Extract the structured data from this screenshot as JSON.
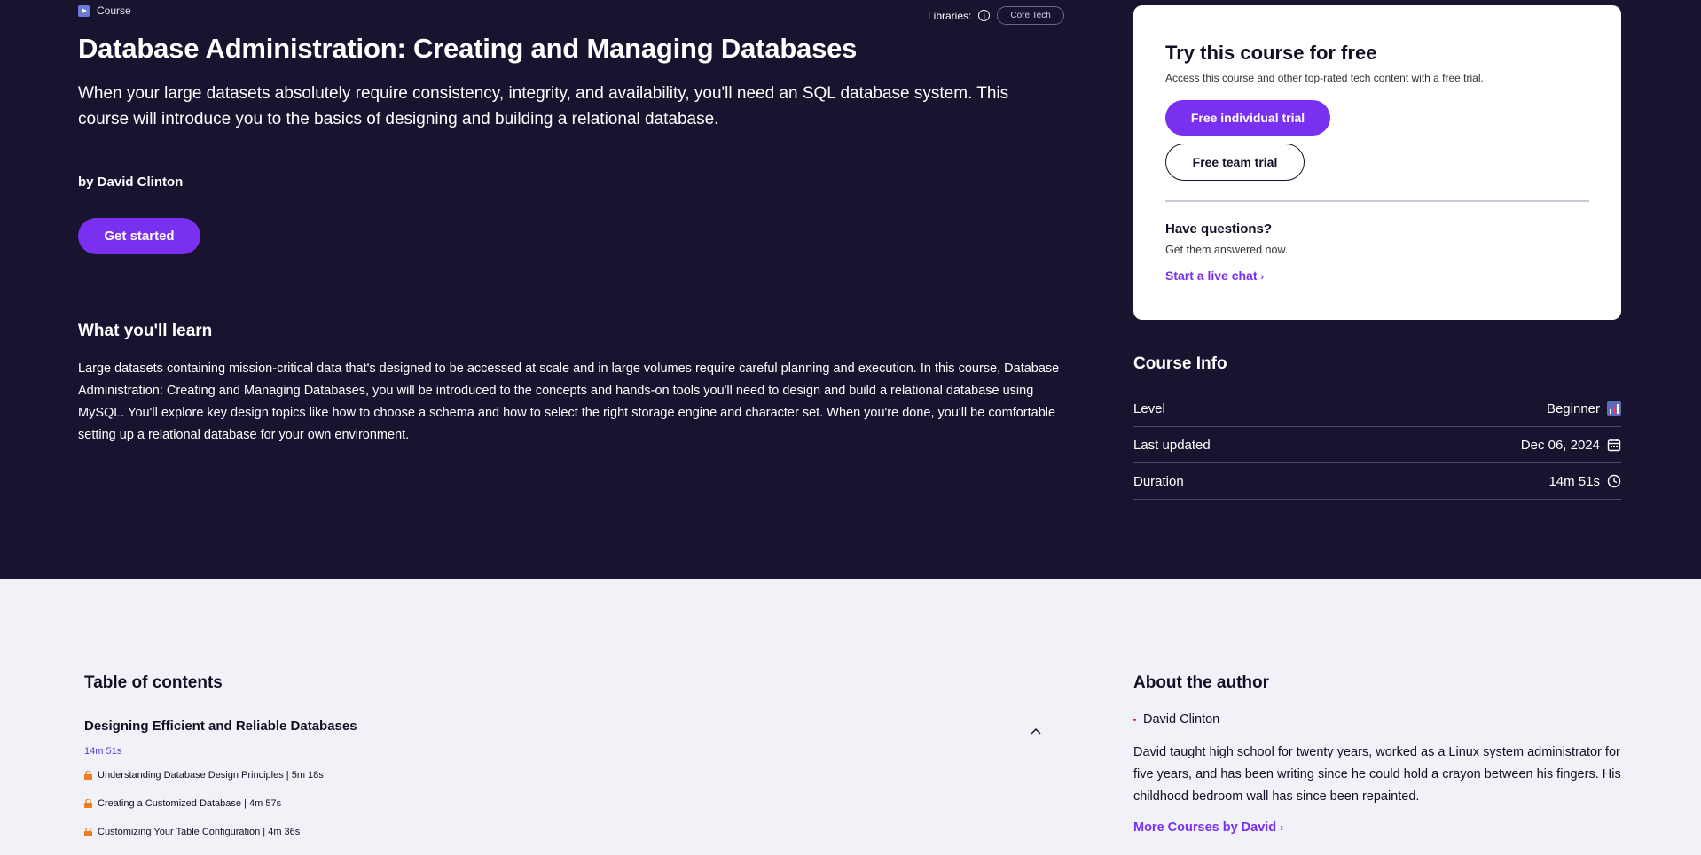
{
  "breadcrumb": {
    "label": "Course"
  },
  "libraries": {
    "label": "Libraries:",
    "chip": "Core Tech"
  },
  "course": {
    "title": "Database Administration: Creating and Managing Databases",
    "subtitle": "When your large datasets absolutely require consistency, integrity, and availability, you'll need an SQL database system. This course will introduce you to the basics of designing and building a relational database.",
    "author": "by David Clinton",
    "cta": "Get started"
  },
  "learn": {
    "heading": "What you'll learn",
    "body": "Large datasets containing mission-critical data that's designed to be accessed at scale and in large volumes require careful planning and execution. In this course, Database Administration: Creating and Managing Databases, you will be introduced to the concepts and hands-on tools you'll need to design and build a relational database using MySQL. You'll explore key design topics like how to choose a schema and how to select the right storage engine and character set. When you're done, you'll be comfortable setting up a relational database for your own environment."
  },
  "trial_card": {
    "heading": "Try this course for free",
    "sub": "Access this course and other top-rated tech content with a free trial.",
    "individual": "Free individual trial",
    "team": "Free team trial",
    "questions": "Have questions?",
    "answered": "Get them answered now.",
    "chat": "Start a live chat"
  },
  "course_info": {
    "heading": "Course Info",
    "rows": [
      {
        "label": "Level",
        "value": "Beginner",
        "icon": "bar-chart-icon"
      },
      {
        "label": "Last updated",
        "value": "Dec 06, 2024",
        "icon": "calendar-icon"
      },
      {
        "label": "Duration",
        "value": "14m 51s",
        "icon": "clock-icon"
      }
    ]
  },
  "toc": {
    "heading": "Table of contents",
    "module": {
      "title": "Designing Efficient and Reliable Databases",
      "duration": "14m 51s"
    },
    "lessons": [
      "Understanding Database Design Principles | 5m 18s",
      "Creating a Customized Database | 4m 57s",
      "Customizing Your Table Configuration | 4m 36s"
    ]
  },
  "about": {
    "heading": "About the author",
    "name": "David Clinton",
    "bio": "David taught high school for twenty years, worked as a Linux system administrator for five years, and has been writing since he could hold a crayon between his fingers. His childhood bedroom wall has since been repainted.",
    "more": "More Courses by David"
  },
  "colors": {
    "hero_bg": "#181430",
    "accent": "#7a30f0",
    "page_bg": "#f0f2f7"
  }
}
